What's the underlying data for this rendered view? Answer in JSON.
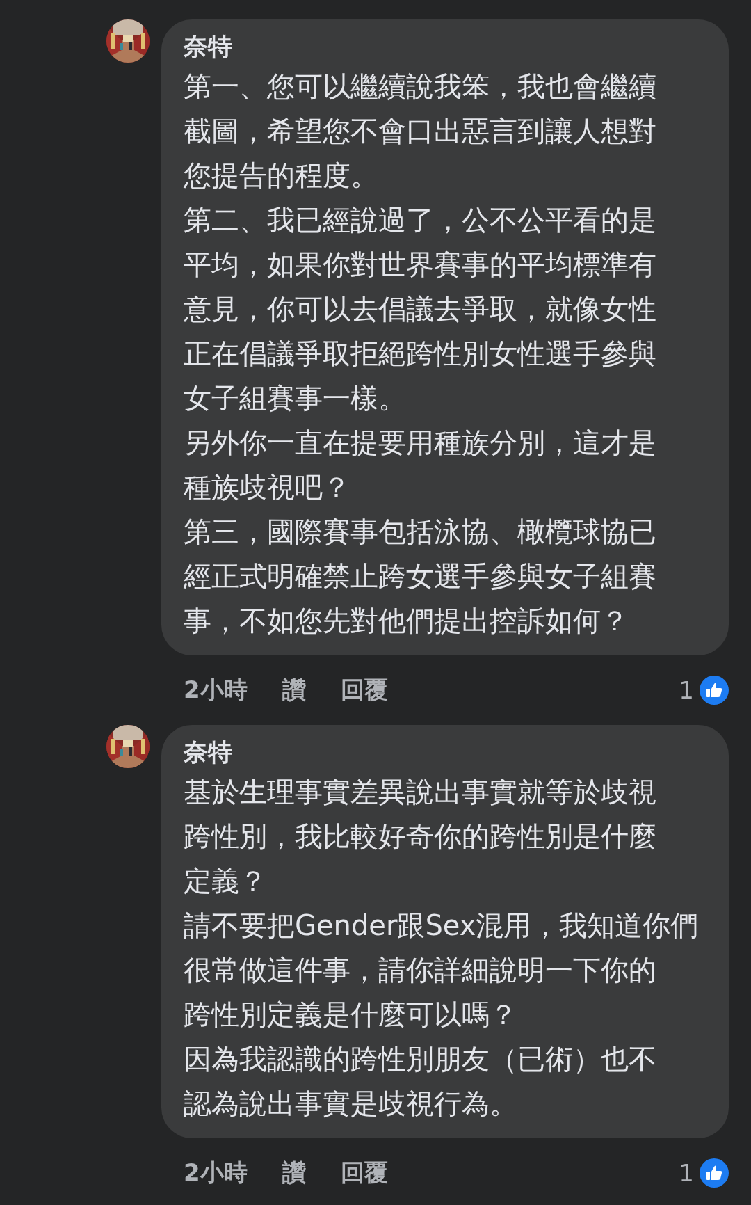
{
  "comments": [
    {
      "author": "奈特",
      "avatar": {
        "kind": "picture"
      },
      "paragraphs": [
        {
          "lines": [
            "第一、您可以繼續說我笨，我也會繼續",
            "截圖，希望您不會口出惡言到讓人想對",
            "您提告的程度。"
          ]
        },
        {
          "lines": [
            "第二、我已經說過了，公不公平看的是",
            "平均，如果你對世界賽事的平均標準有",
            "意見，你可以去倡議去爭取，就像女性",
            "正在倡議爭取拒絕跨性別女性選手參與",
            "女子組賽事一樣。"
          ]
        },
        {
          "lines": [
            "另外你一直在提要用種族分別，這才是",
            "種族歧視吧？"
          ]
        },
        {
          "lines": [
            "第三，國際賽事包括泳協、橄欖球協已",
            "經正式明確禁止跨女選手參與女子組賽",
            "事，不如您先對他們提出控訴如何？"
          ]
        }
      ],
      "time": "2小時",
      "like": "讚",
      "reply": "回覆",
      "reaction_count": "1"
    },
    {
      "author": "奈特",
      "avatar": {
        "kind": "picture"
      },
      "paragraphs": [
        {
          "lines": [
            "基於生理事實差異說出事實就等於歧視",
            "跨性別，我比較好奇你的跨性別是什麼",
            "定義？"
          ]
        },
        {
          "lines": [
            "請不要把Gender跟Sex混用，我知道你們",
            "很常做這件事，請你詳細說明一下你的",
            "跨性別定義是什麼可以嗎？"
          ]
        },
        {
          "lines": [
            "因為我認識的跨性別朋友（已術）也不",
            "認為說出事實是歧視行為。"
          ]
        }
      ],
      "time": "2小時",
      "like": "讚",
      "reply": "回覆",
      "reaction_count": "1"
    }
  ]
}
